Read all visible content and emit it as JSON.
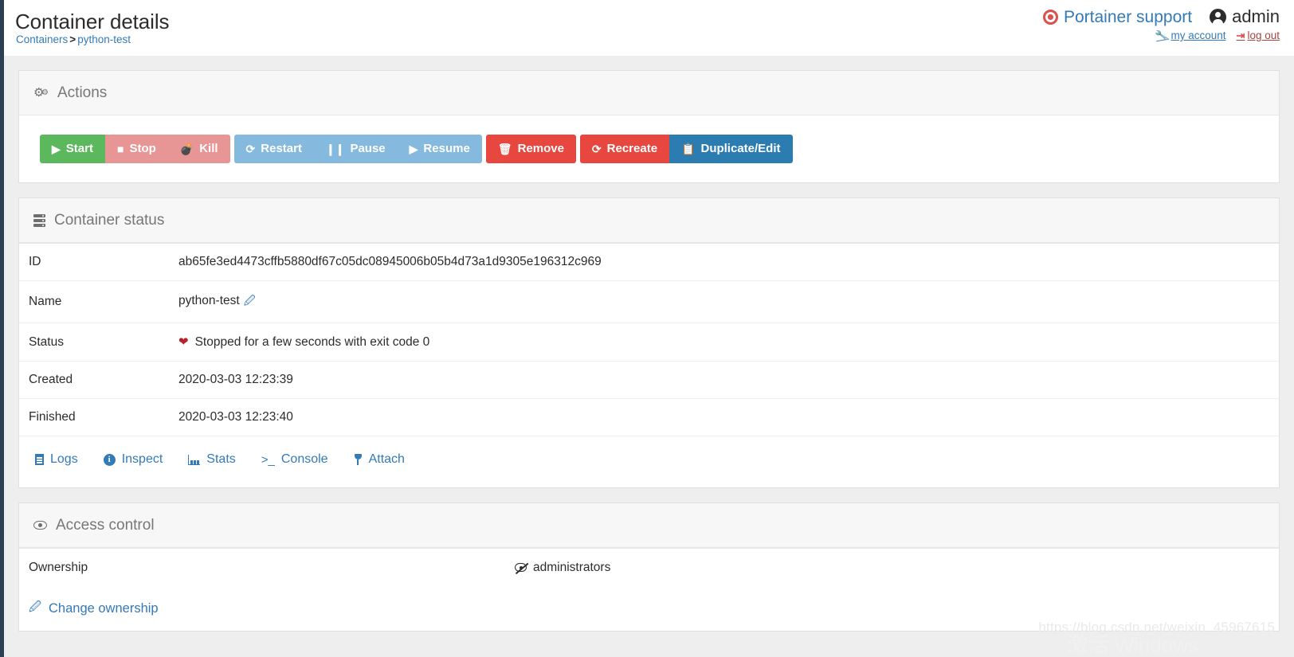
{
  "header": {
    "title": "Container details",
    "breadcrumb": {
      "parent": "Containers",
      "separator": ">",
      "current": "python-test"
    },
    "support_label": "Portainer support",
    "username": "admin",
    "my_account_label": "my account",
    "log_out_label": "log out"
  },
  "actions_panel": {
    "title": "Actions",
    "buttons": [
      {
        "label": "Start",
        "icon": "play-icon",
        "glyph": "▶",
        "color": "#5cb85c"
      },
      {
        "label": "Stop",
        "icon": "stop-icon",
        "glyph": "■",
        "color": "#e79595"
      },
      {
        "label": "Kill",
        "icon": "bomb-icon",
        "glyph": "●",
        "color": "#e79595"
      },
      {
        "label": "Restart",
        "icon": "sync-icon",
        "glyph": "↻",
        "color": "#85b9de"
      },
      {
        "label": "Pause",
        "icon": "pause-icon",
        "glyph": "❙❙",
        "color": "#85b9de"
      },
      {
        "label": "Resume",
        "icon": "play-icon",
        "glyph": "▶",
        "color": "#85b9de"
      },
      {
        "label": "Remove",
        "icon": "trash-icon",
        "glyph": "🗑",
        "color": "#e8473f"
      },
      {
        "label": "Recreate",
        "icon": "sync-icon",
        "glyph": "↻",
        "color": "#e8473f"
      },
      {
        "label": "Duplicate/Edit",
        "icon": "copy-icon",
        "glyph": "❐",
        "color": "#2b7cb0"
      }
    ]
  },
  "status_panel": {
    "title": "Container status",
    "rows": [
      {
        "key": "ID",
        "value": "ab65fe3ed4473cffb5880df67c05dc08945006b05b4d73a1d9305e196312c969",
        "editable": false,
        "heart": false
      },
      {
        "key": "Name",
        "value": "python-test",
        "editable": true,
        "heart": false
      },
      {
        "key": "Status",
        "value": "Stopped for a few seconds with exit code 0",
        "editable": false,
        "heart": true
      },
      {
        "key": "Created",
        "value": "2020-03-03 12:23:39",
        "editable": false,
        "heart": false
      },
      {
        "key": "Finished",
        "value": "2020-03-03 12:23:40",
        "editable": false,
        "heart": false
      }
    ],
    "quick_links": [
      {
        "label": "Logs",
        "icon": "file-icon"
      },
      {
        "label": "Inspect",
        "icon": "info-circle-icon"
      },
      {
        "label": "Stats",
        "icon": "chart-icon"
      },
      {
        "label": "Console",
        "icon": "terminal-icon"
      },
      {
        "label": "Attach",
        "icon": "plug-icon"
      }
    ]
  },
  "access_panel": {
    "title": "Access control",
    "ownership_label": "Ownership",
    "ownership_value": "administrators",
    "change_ownership_label": "Change ownership"
  },
  "watermarks": {
    "url": "https://blog.csdn.net/weixin_45967615",
    "activate": "激活 Windows"
  },
  "colors": {
    "link": "#337ab7",
    "danger": "#d9534f",
    "success": "#5cb85c",
    "sidebar": "#2d3e54"
  }
}
